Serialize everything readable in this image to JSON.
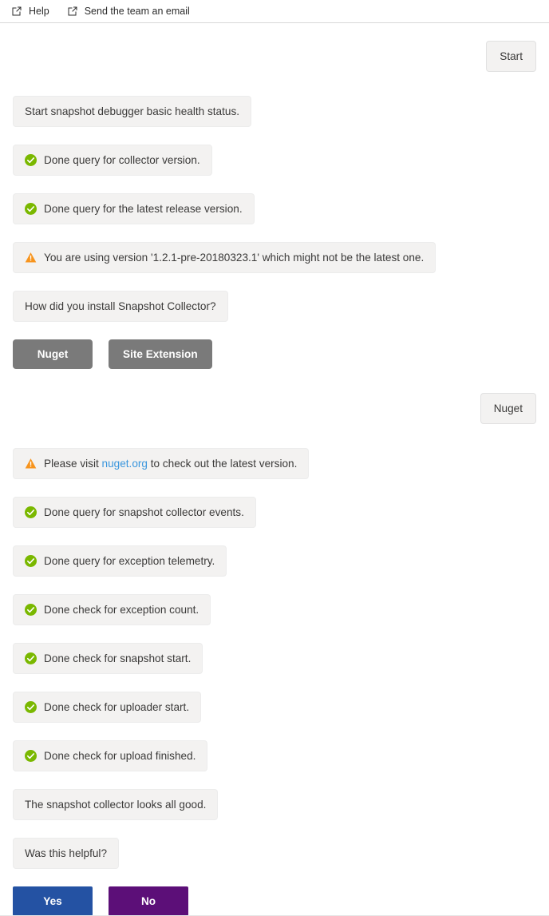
{
  "header": {
    "links": [
      {
        "label": "Help",
        "icon": "external-link-icon"
      },
      {
        "label": "Send the team an email",
        "icon": "external-link-icon"
      }
    ]
  },
  "start_button": {
    "label": "Start"
  },
  "messages": [
    {
      "icon": "none",
      "text": "Start snapshot debugger basic health status."
    },
    {
      "icon": "success",
      "text": "Done query for collector version."
    },
    {
      "icon": "success",
      "text": "Done query for the latest release version."
    },
    {
      "icon": "warning",
      "text": "You are using version '1.2.1-pre-20180323.1' which might not be the latest one."
    },
    {
      "icon": "none",
      "text": "How did you install Snapshot Collector?"
    }
  ],
  "choices": [
    {
      "label": "Nuget"
    },
    {
      "label": "Site Extension"
    }
  ],
  "user_reply": {
    "label": "Nuget"
  },
  "link_message": {
    "icon": "warning",
    "prefix": "Please visit ",
    "link_text": "nuget.org",
    "suffix": " to check out the latest version."
  },
  "messages2": [
    {
      "icon": "success",
      "text": "Done query for snapshot collector events."
    },
    {
      "icon": "success",
      "text": "Done query for exception telemetry."
    },
    {
      "icon": "success",
      "text": "Done check for exception count."
    },
    {
      "icon": "success",
      "text": "Done check for snapshot start."
    },
    {
      "icon": "success",
      "text": "Done check for uploader start."
    },
    {
      "icon": "success",
      "text": "Done check for upload finished."
    },
    {
      "icon": "none",
      "text": "The snapshot collector looks all good."
    },
    {
      "icon": "none",
      "text": "Was this helpful?"
    }
  ],
  "feedback": [
    {
      "label": "Yes",
      "color": "#2452a3"
    },
    {
      "label": "No",
      "color": "#5c0f78"
    }
  ],
  "colors": {
    "success_green": "#7ab800",
    "warning_orange": "#f7941d",
    "link_blue": "#3a96dd",
    "bubble_bg": "#f3f2f1",
    "choice_gray": "#7a7a7a"
  }
}
